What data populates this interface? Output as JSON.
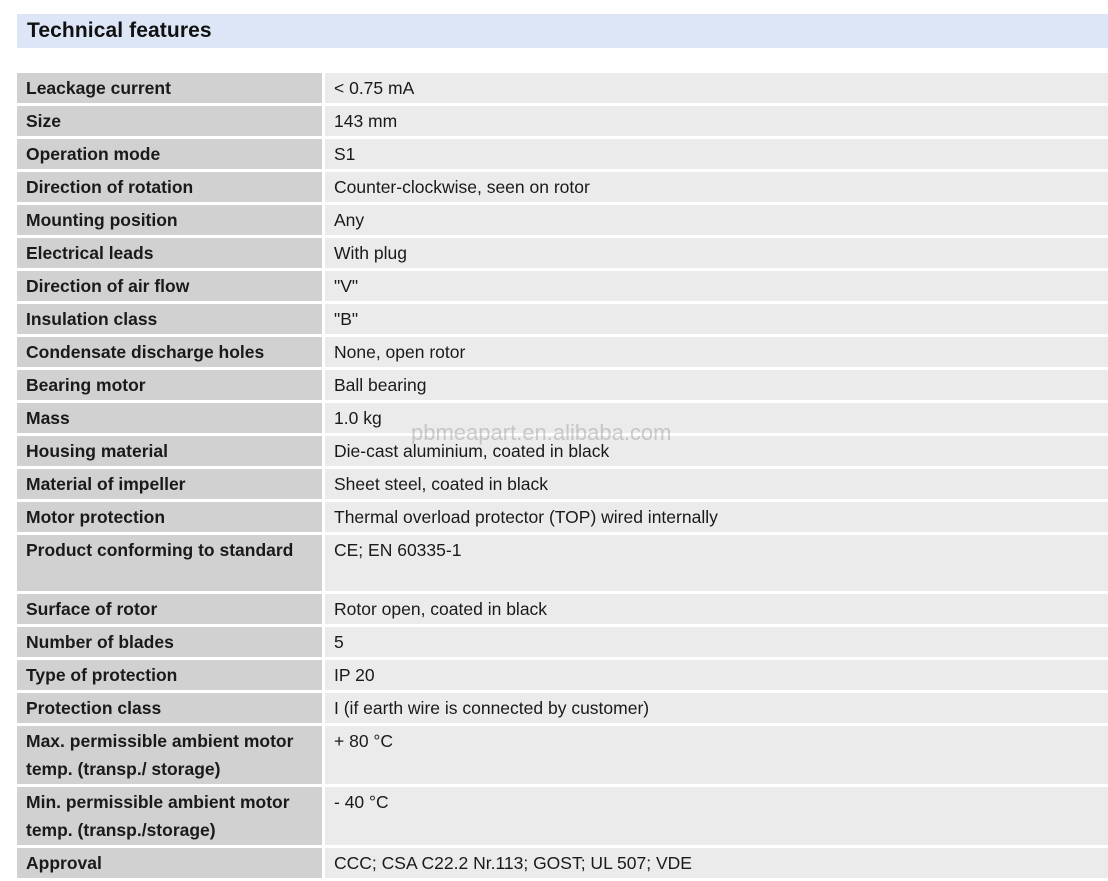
{
  "header": {
    "title": "Technical features"
  },
  "features": [
    {
      "label": "Leackage current",
      "value": "< 0.75 mA"
    },
    {
      "label": "Size",
      "value": "143 mm"
    },
    {
      "label": "Operation mode",
      "value": "S1"
    },
    {
      "label": "Direction of rotation",
      "value": "Counter-clockwise, seen on rotor"
    },
    {
      "label": "Mounting position",
      "value": "Any"
    },
    {
      "label": "Electrical leads",
      "value": "With plug"
    },
    {
      "label": "Direction of air flow",
      "value": "\"V\""
    },
    {
      "label": "Insulation class",
      "value": "\"B\""
    },
    {
      "label": "Condensate discharge holes",
      "value": "None, open rotor"
    },
    {
      "label": "Bearing motor",
      "value": "Ball bearing"
    },
    {
      "label": "Mass",
      "value": "1.0 kg"
    },
    {
      "label": "Housing material",
      "value": "Die-cast aluminium, coated in black"
    },
    {
      "label": "Material of impeller",
      "value": "Sheet steel, coated in black"
    },
    {
      "label": "Motor protection",
      "value": "Thermal overload protector (TOP) wired internally"
    },
    {
      "label": "Product conforming to standard",
      "value": "CE; EN 60335-1"
    },
    {
      "label": "Surface of rotor",
      "value": "Rotor open, coated in black"
    },
    {
      "label": "Number of blades",
      "value": "5"
    },
    {
      "label": "Type of protection",
      "value": "IP 20"
    },
    {
      "label": "Protection class",
      "value": "I (if earth wire is connected by customer)"
    },
    {
      "label": "Max. permissible ambient motor temp. (transp./ storage)",
      "value": "+ 80 °C"
    },
    {
      "label": "Min. permissible ambient motor temp. (transp./storage)",
      "value": "- 40 °C"
    },
    {
      "label": "Approval",
      "value": "CCC; CSA C22.2 Nr.113; GOST; UL 507; VDE"
    }
  ],
  "watermark": "pbmeapart.en.alibaba.com"
}
